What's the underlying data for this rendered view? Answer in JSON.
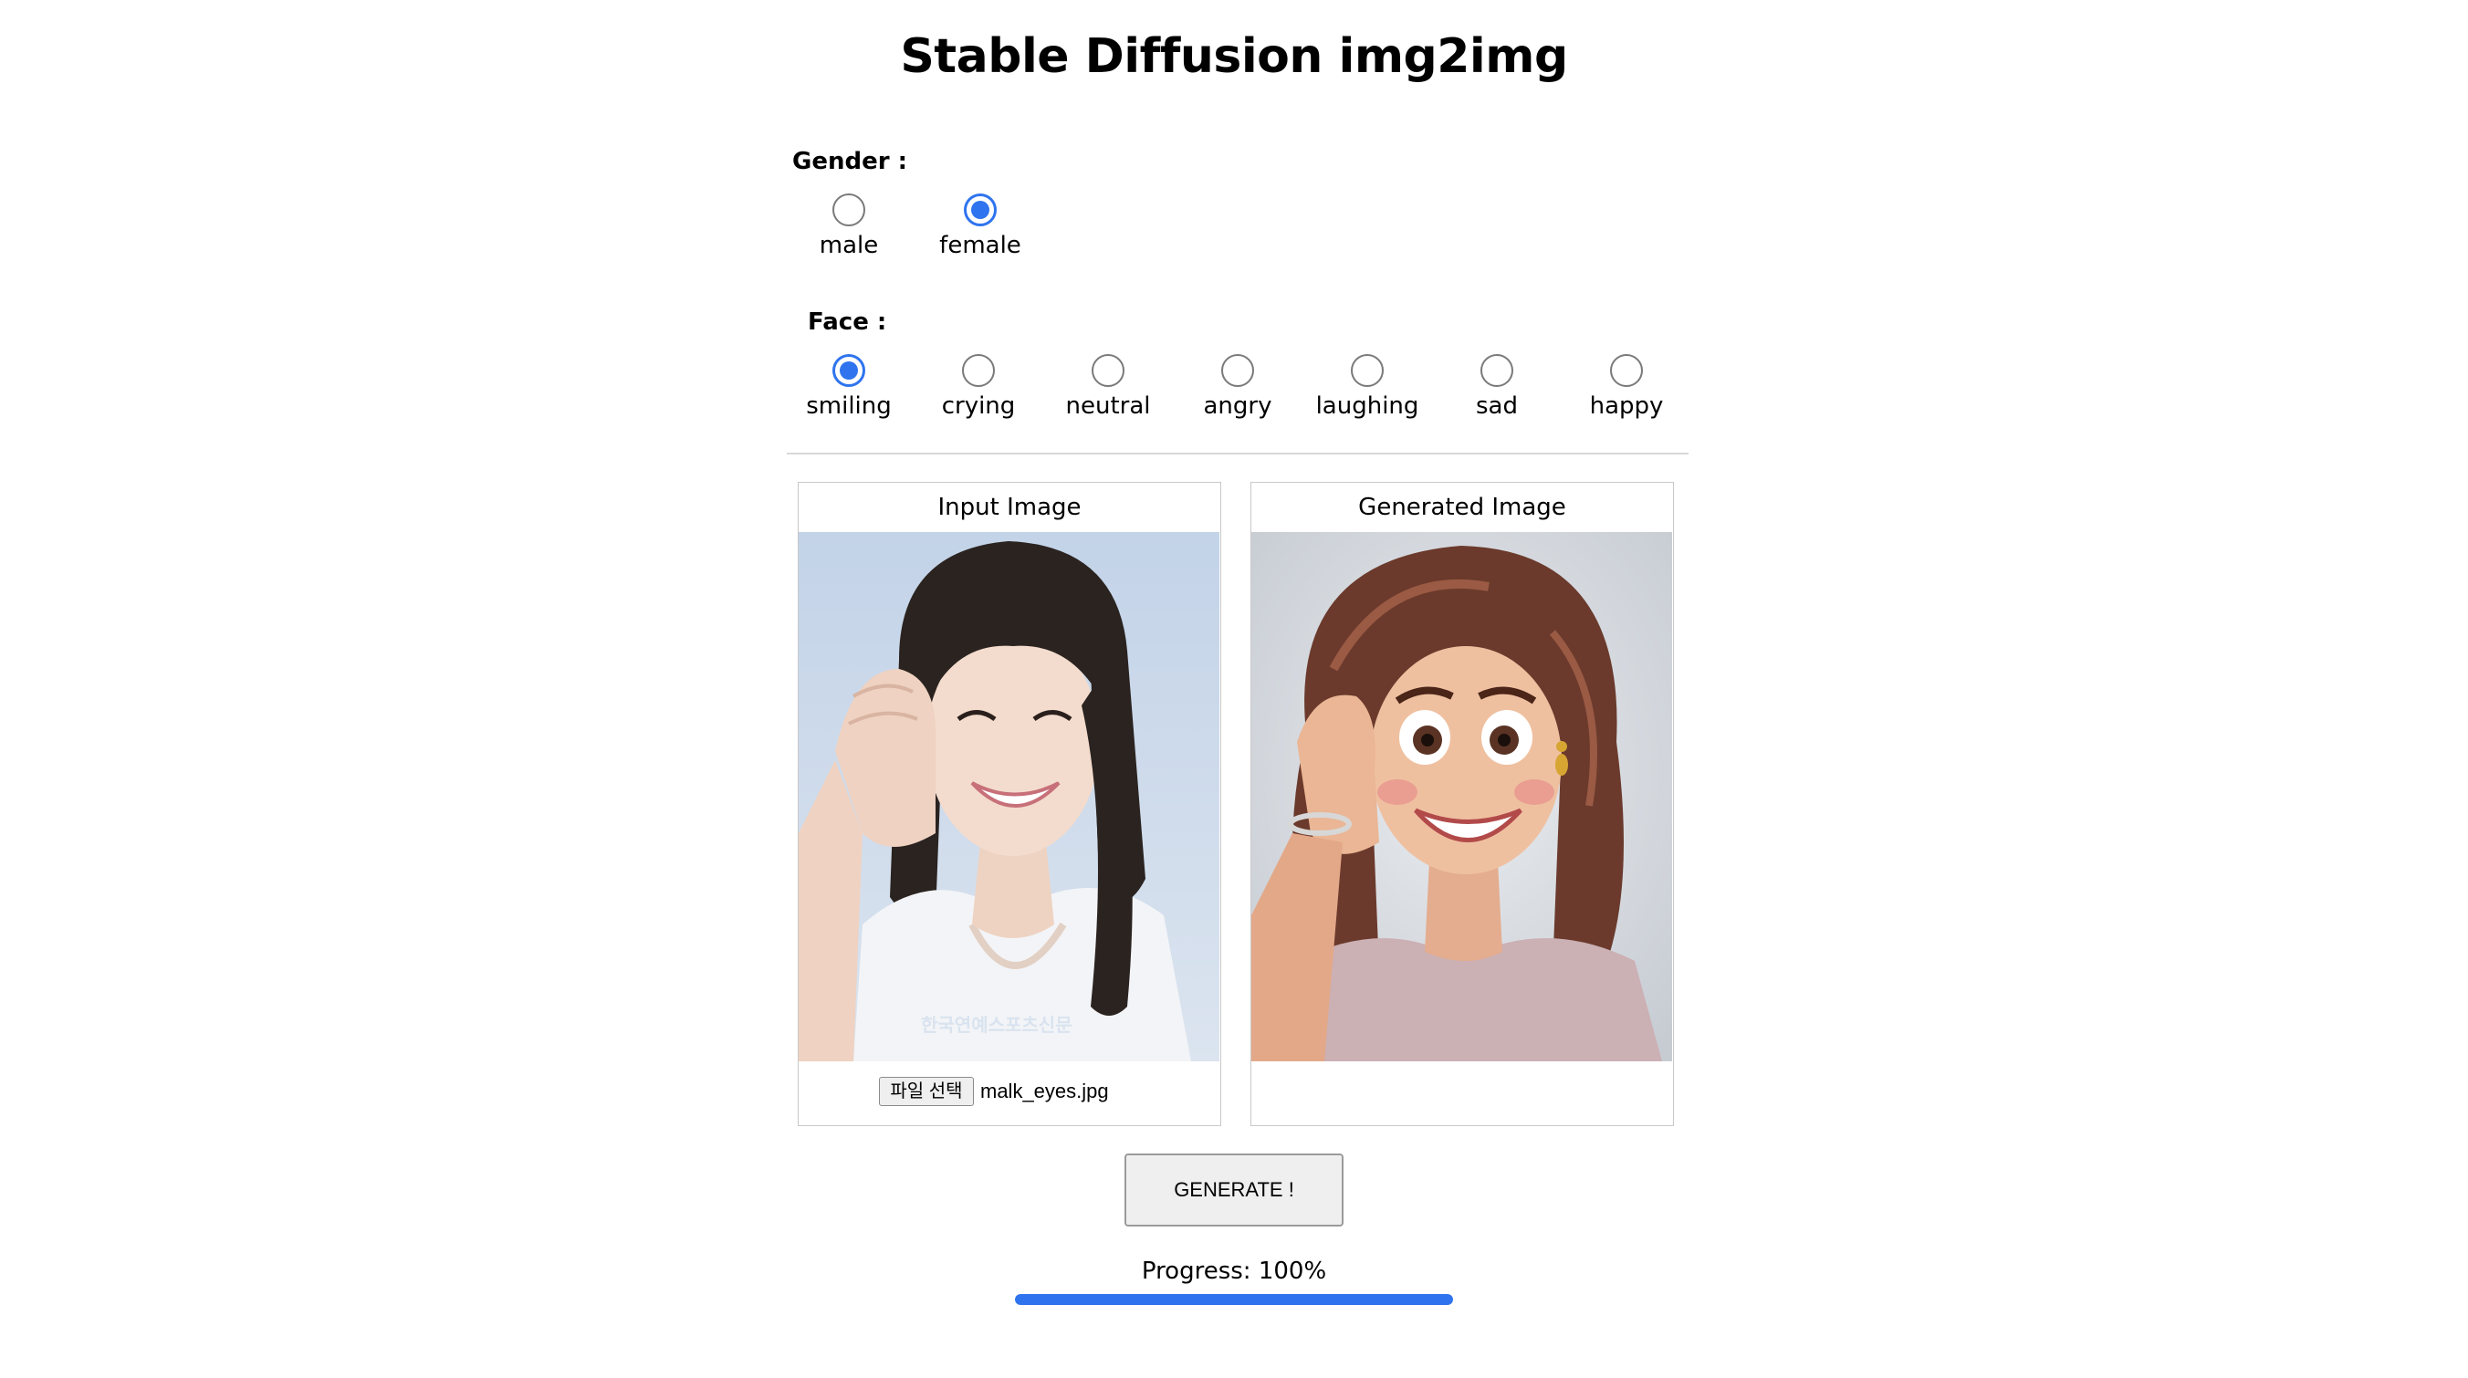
{
  "title": "Stable Diffusion img2img",
  "gender": {
    "label": "Gender :",
    "options": [
      {
        "label": "male",
        "checked": false
      },
      {
        "label": "female",
        "checked": true
      }
    ]
  },
  "face": {
    "label": "Face :",
    "options": [
      {
        "label": "smiling",
        "checked": true
      },
      {
        "label": "crying",
        "checked": false
      },
      {
        "label": "neutral",
        "checked": false
      },
      {
        "label": "angry",
        "checked": false
      },
      {
        "label": "laughing",
        "checked": false
      },
      {
        "label": "sad",
        "checked": false
      },
      {
        "label": "happy",
        "checked": false
      }
    ]
  },
  "input_panel": {
    "title": "Input Image",
    "watermark": "한국연예스포츠신문",
    "file_button": "파일 선택",
    "file_name": "malk_eyes.jpg"
  },
  "output_panel": {
    "title": "Generated Image"
  },
  "generate_button": "GENERATE !",
  "progress": {
    "text": "Progress: 100%",
    "value": 1.0
  },
  "colors": {
    "accent": "#2f74ee"
  }
}
